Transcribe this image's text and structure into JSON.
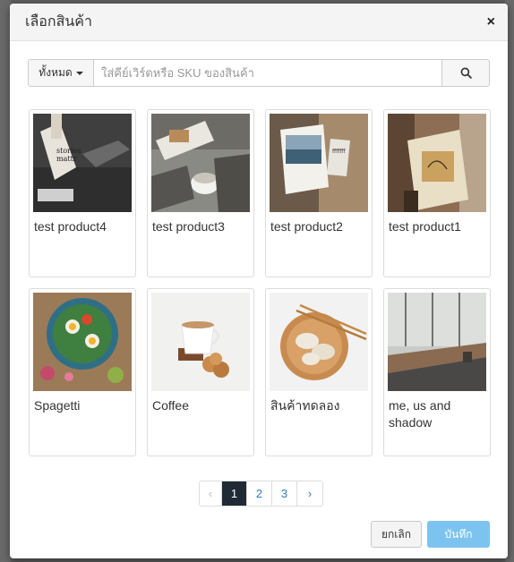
{
  "modal": {
    "title": "เลือกสินค้า",
    "close_symbol": "×"
  },
  "search": {
    "category_label": "ทั้งหมด",
    "placeholder": "ใส่คีย์เวิร์ดหรือ SKU ของสินค้า",
    "value": "",
    "button_icon": "search-icon"
  },
  "products": [
    {
      "name": "test product4",
      "image": "editorial booklet on dark floor"
    },
    {
      "name": "test product3",
      "image": "booklet with coffee cup"
    },
    {
      "name": "test product2",
      "image": "ocean print magazine"
    },
    {
      "name": "test product1",
      "image": "person holding art book"
    },
    {
      "name": "Spagetti",
      "image": "salad bowl"
    },
    {
      "name": "Coffee",
      "image": "coffee cup with cookies"
    },
    {
      "name": "สินค้าทดลอง",
      "image": "dumplings with chopsticks"
    },
    {
      "name": "me, us and shadow",
      "image": "window shadows"
    }
  ],
  "pagination": {
    "prev": "‹",
    "pages": [
      "1",
      "2",
      "3"
    ],
    "current": "1",
    "next": "›"
  },
  "footer": {
    "cancel_label": "ยกเลิก",
    "save_label": "บันทึก"
  },
  "colors": {
    "accent": "#7cc4ef",
    "active_page": "#1f2a36",
    "link": "#337ab7"
  }
}
